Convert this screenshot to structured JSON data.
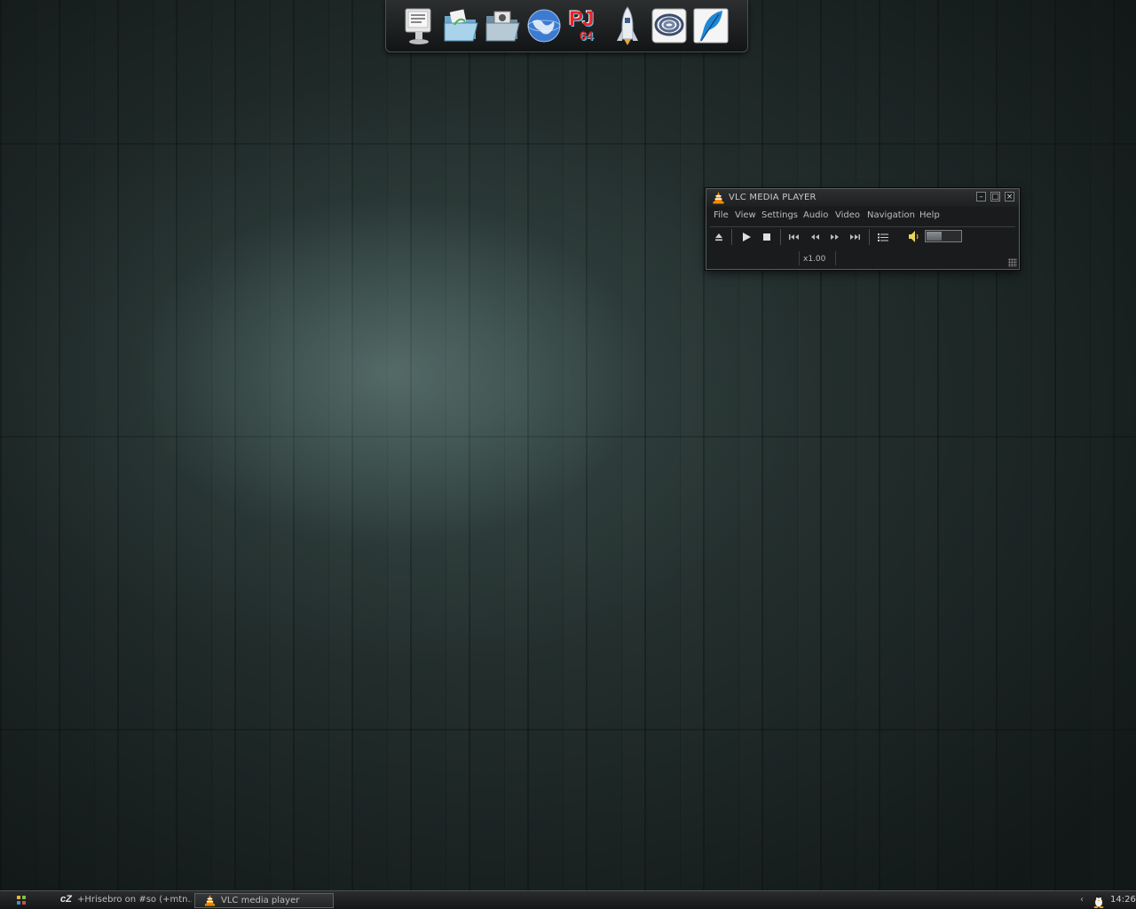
{
  "dock": {
    "icons": [
      {
        "name": "monitor-icon"
      },
      {
        "name": "folder-open-icon"
      },
      {
        "name": "folder-pictures-icon"
      },
      {
        "name": "globe-icon"
      },
      {
        "name": "pj64-icon",
        "label": "PJ",
        "sub": "64"
      },
      {
        "name": "rocket-shuttle-icon"
      },
      {
        "name": "spiral-app-icon"
      },
      {
        "name": "feather-icon"
      }
    ]
  },
  "vlc": {
    "title": "VLC MEDIA PLAYER",
    "menu": [
      "File",
      "View",
      "Settings",
      "Audio",
      "Video",
      "Navigation",
      "Help"
    ],
    "speed": "x1.00",
    "volume_level": 0.45,
    "window_buttons": {
      "minimize": "–",
      "maximize": "□",
      "close": "×"
    }
  },
  "taskbar": {
    "tasks": [
      {
        "label": "+Hrisebro on #so (+mtn...",
        "icon": "cz-icon",
        "icon_text": "cZ"
      },
      {
        "label": "VLC media player",
        "icon": "vlc-cone-icon"
      }
    ],
    "clock": "14:26",
    "tray_arrow": "‹"
  },
  "colors": {
    "vlc_orange": "#f28b00",
    "wallpaper": "#2b3a38",
    "panel": "#1a1b1c"
  }
}
